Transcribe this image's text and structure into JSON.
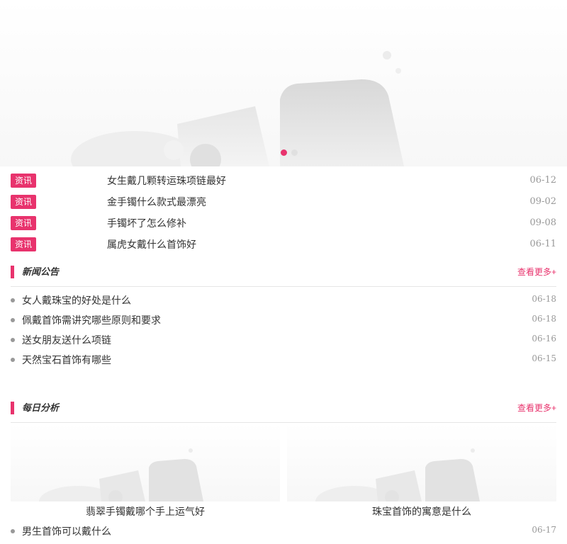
{
  "banner": {
    "image_icon": "image-placeholder-icon",
    "slides": 2,
    "active_slide": 1
  },
  "news": [
    {
      "tag": "资讯",
      "title": "女生戴几颗转运珠项链最好",
      "date": "06-12"
    },
    {
      "tag": "资讯",
      "title": "金手镯什么款式最漂亮",
      "date": "09-02"
    },
    {
      "tag": "资讯",
      "title": "手镯坏了怎么修补",
      "date": "09-08"
    },
    {
      "tag": "资讯",
      "title": "属虎女戴什么首饰好",
      "date": "06-11"
    }
  ],
  "announcements": {
    "title": "新闻公告",
    "more": "查看更多+",
    "items": [
      {
        "title": "女人戴珠宝的好处是什么",
        "date": "06-18"
      },
      {
        "title": "佩戴首饰需讲究哪些原则和要求",
        "date": "06-18"
      },
      {
        "title": "送女朋友送什么项链",
        "date": "06-16"
      },
      {
        "title": "天然宝石首饰有哪些",
        "date": "06-15"
      }
    ]
  },
  "daily": {
    "title": "每日分析",
    "more": "查看更多+",
    "cards": [
      {
        "caption": "翡翠手镯戴哪个手上运气好"
      },
      {
        "caption": "珠宝首饰的寓意是什么"
      }
    ],
    "items": [
      {
        "title": "男生首饰可以戴什么",
        "date": "06-17"
      }
    ]
  },
  "colors": {
    "accent": "#e8336d",
    "muted": "#999999",
    "text": "#333333"
  }
}
